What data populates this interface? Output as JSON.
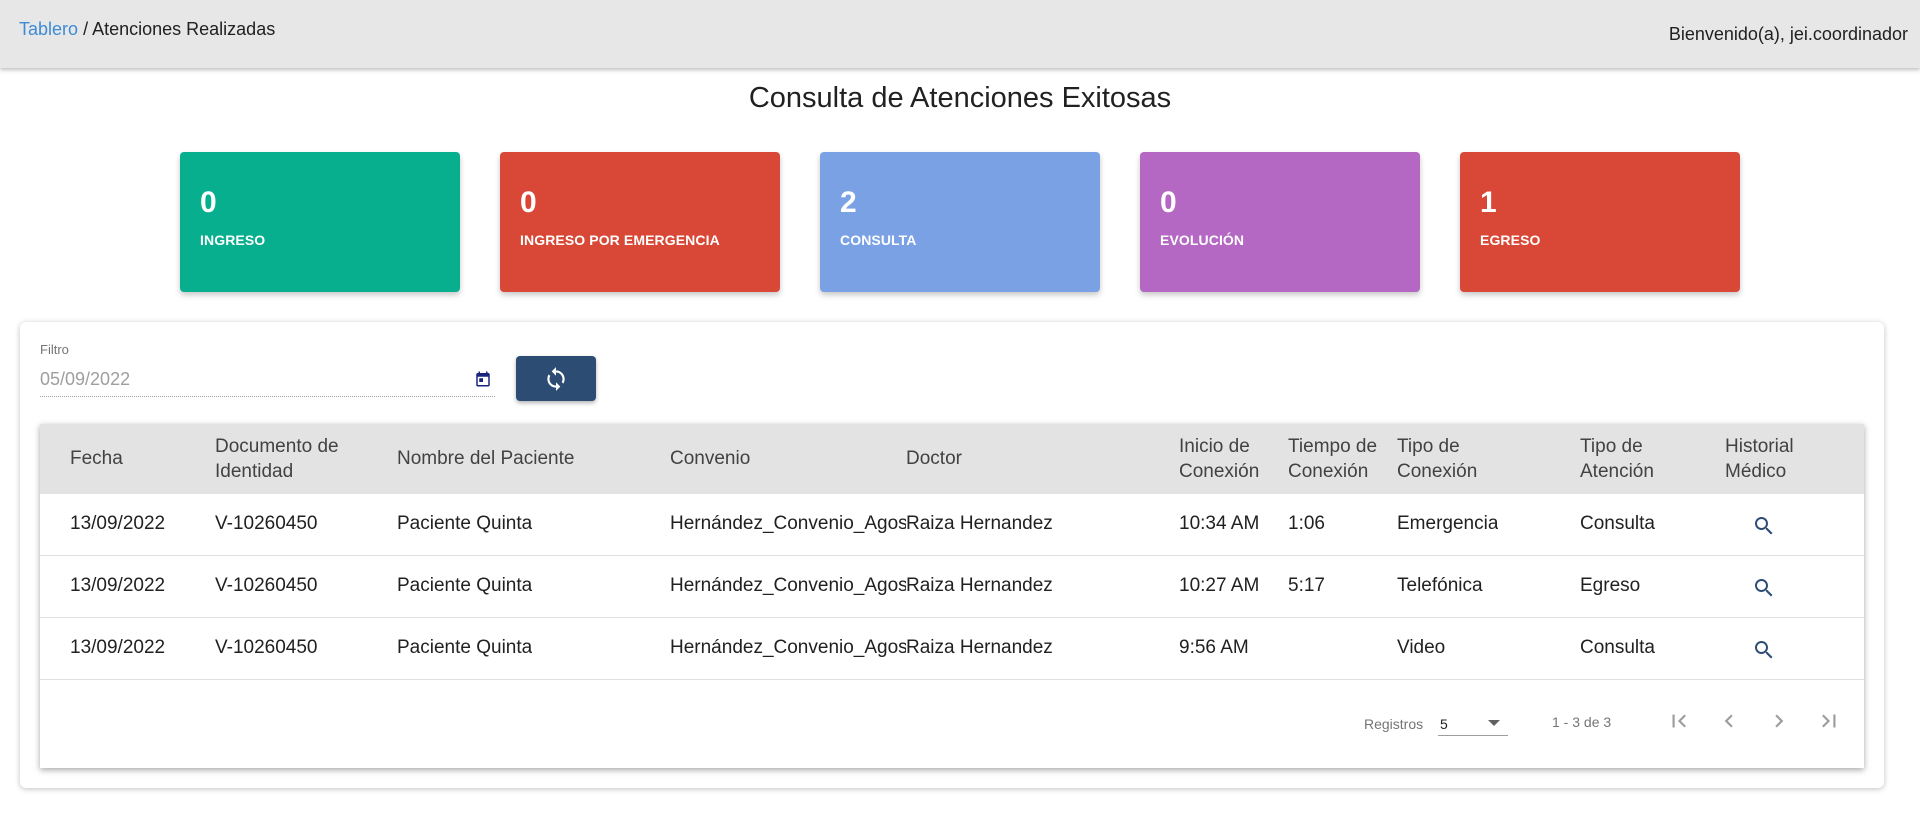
{
  "header": {
    "breadcrumb_link": "Tablero",
    "breadcrumb_separator": "/",
    "breadcrumb_current": "Atenciones Realizadas",
    "welcome": "Bienvenido(a), jei.coordinador"
  },
  "page_title": "Consulta de Atenciones Exitosas",
  "cards": [
    {
      "value": "0",
      "label": "INGRESO",
      "color": "#07af8f"
    },
    {
      "value": "0",
      "label": "INGRESO POR EMERGENCIA",
      "color": "#d94836"
    },
    {
      "value": "2",
      "label": "CONSULTA",
      "color": "#7ba1e5"
    },
    {
      "value": "0",
      "label": "EVOLUCIÓN",
      "color": "#b467c3"
    },
    {
      "value": "1",
      "label": "EGRESO",
      "color": "#d94836"
    }
  ],
  "filter": {
    "label": "Filtro",
    "value": "05/09/2022",
    "icon": "calendar-icon"
  },
  "refresh_button": {
    "icon": "refresh-icon",
    "color": "#2c4c73"
  },
  "table": {
    "headers": {
      "fecha": "Fecha",
      "documento_1": "Documento de",
      "documento_2": "Identidad",
      "nombre": "Nombre del Paciente",
      "convenio": "Convenio",
      "doctor": "Doctor",
      "inicio_1": "Inicio de",
      "inicio_2": "Conexión",
      "tiempo_1": "Tiempo de",
      "tiempo_2": "Conexión",
      "tipo_con_1": "Tipo de",
      "tipo_con_2": "Conexión",
      "tipo_at_1": "Tipo de",
      "tipo_at_2": "Atención",
      "historial_1": "Historial",
      "historial_2": "Médico"
    },
    "rows": [
      {
        "fecha": "13/09/2022",
        "documento": "V-10260450",
        "nombre": "Paciente Quinta",
        "convenio": "Hernández_Convenio_Agos",
        "doctor": "Raiza Hernandez",
        "inicio": "10:34 AM",
        "tiempo": "1:06",
        "tipo_conexion": "Emergencia",
        "tipo_atencion": "Consulta"
      },
      {
        "fecha": "13/09/2022",
        "documento": "V-10260450",
        "nombre": "Paciente Quinta",
        "convenio": "Hernández_Convenio_Agos",
        "doctor": "Raiza Hernandez",
        "inicio": "10:27 AM",
        "tiempo": "5:17",
        "tipo_conexion": "Telefónica",
        "tipo_atencion": "Egreso"
      },
      {
        "fecha": "13/09/2022",
        "documento": "V-10260450",
        "nombre": "Paciente Quinta",
        "convenio": "Hernández_Convenio_Agos",
        "doctor": "Raiza Hernandez",
        "inicio": "9:56 AM",
        "tiempo": "",
        "tipo_conexion": "Video",
        "tipo_atencion": "Consulta"
      }
    ]
  },
  "pager": {
    "label": "Registros",
    "page_size": "5",
    "range": "1 - 3 de 3"
  }
}
